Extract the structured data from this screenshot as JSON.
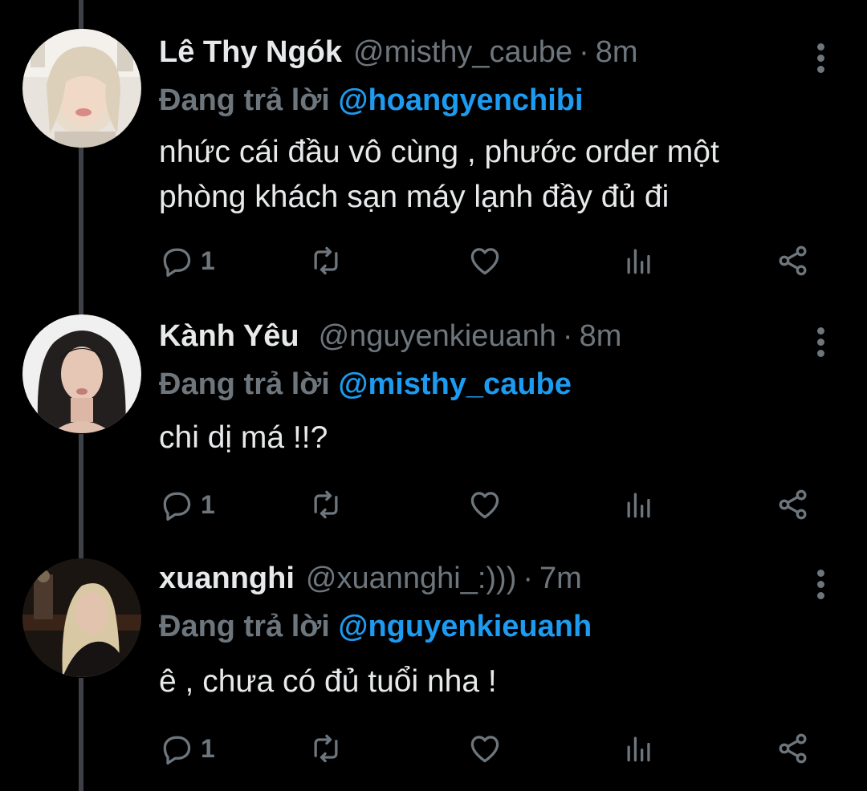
{
  "reply_prefix": "Đang trả lời",
  "tweets": [
    {
      "name": "Lê Thy Ngók",
      "handle": "@misthy_caube",
      "separator": "·",
      "time": "8m",
      "reply_to": "@hoangyenchibi",
      "lines": [
        "nhức cái đầu vô cùng , phước order một",
        "phòng khách sạn máy lạnh đầy đủ đi"
      ],
      "reply_count": "1"
    },
    {
      "name": "Kành Yêu",
      "handle": "@nguyenkieuanh",
      "separator": "·",
      "time": "8m",
      "reply_to": "@misthy_caube",
      "lines": [
        "chi dị má !!?"
      ],
      "reply_count": "1"
    },
    {
      "name": "xuannghi",
      "handle": "@xuannghi_:)))",
      "separator": "·",
      "time": "7m",
      "reply_to": "@nguyenkieuanh",
      "lines": [
        "ê , chưa có đủ tuổi nha !"
      ],
      "reply_count": "1"
    }
  ],
  "colors": {
    "background": "#000000",
    "text": "#e7e9ea",
    "muted": "#6e767d",
    "mention": "#1d9bf0",
    "thread_line": "#3d4147"
  },
  "icons": [
    "reply-icon",
    "retweet-icon",
    "like-icon",
    "analytics-icon",
    "share-icon",
    "more-icon"
  ]
}
